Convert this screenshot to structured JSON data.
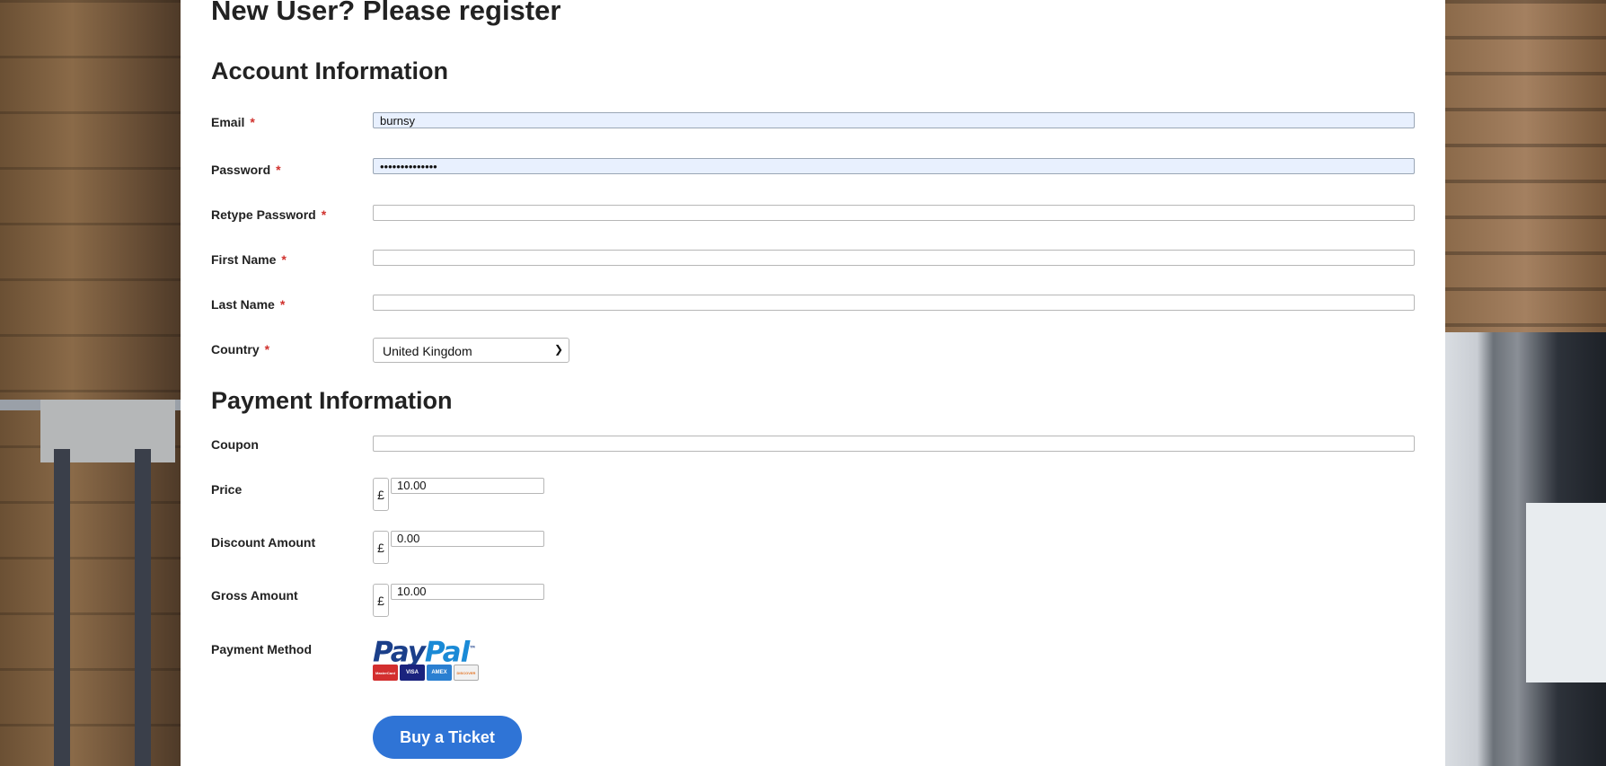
{
  "page": {
    "title": "New User? Please register"
  },
  "account": {
    "heading": "Account Information",
    "fields": {
      "email": {
        "label": "Email",
        "required": "*",
        "value": "burnsy"
      },
      "password": {
        "label": "Password",
        "required": "*",
        "value": "••••••••••••••"
      },
      "retype_password": {
        "label": "Retype Password",
        "required": "*",
        "value": ""
      },
      "first_name": {
        "label": "First Name",
        "required": "*",
        "value": ""
      },
      "last_name": {
        "label": "Last Name",
        "required": "*",
        "value": ""
      },
      "country": {
        "label": "Country",
        "required": "*",
        "value": "United Kingdom"
      }
    }
  },
  "payment": {
    "heading": "Payment Information",
    "coupon": {
      "label": "Coupon",
      "value": ""
    },
    "price": {
      "label": "Price",
      "currency": "£",
      "value": "10.00"
    },
    "discount": {
      "label": "Discount Amount",
      "currency": "£",
      "value": "0.00"
    },
    "gross": {
      "label": "Gross Amount",
      "currency": "£",
      "value": "10.00"
    },
    "method": {
      "label": "Payment Method",
      "logo_pay": "Pay",
      "logo_pal": "Pal",
      "cards": [
        "MasterCard",
        "VISA",
        "AMEX",
        "DISCOVER"
      ]
    }
  },
  "actions": {
    "buy_label": "Buy a Ticket"
  },
  "colors": {
    "button": "#2f74d6",
    "required": "#d0312d",
    "autofill": "#e8f0fe"
  }
}
